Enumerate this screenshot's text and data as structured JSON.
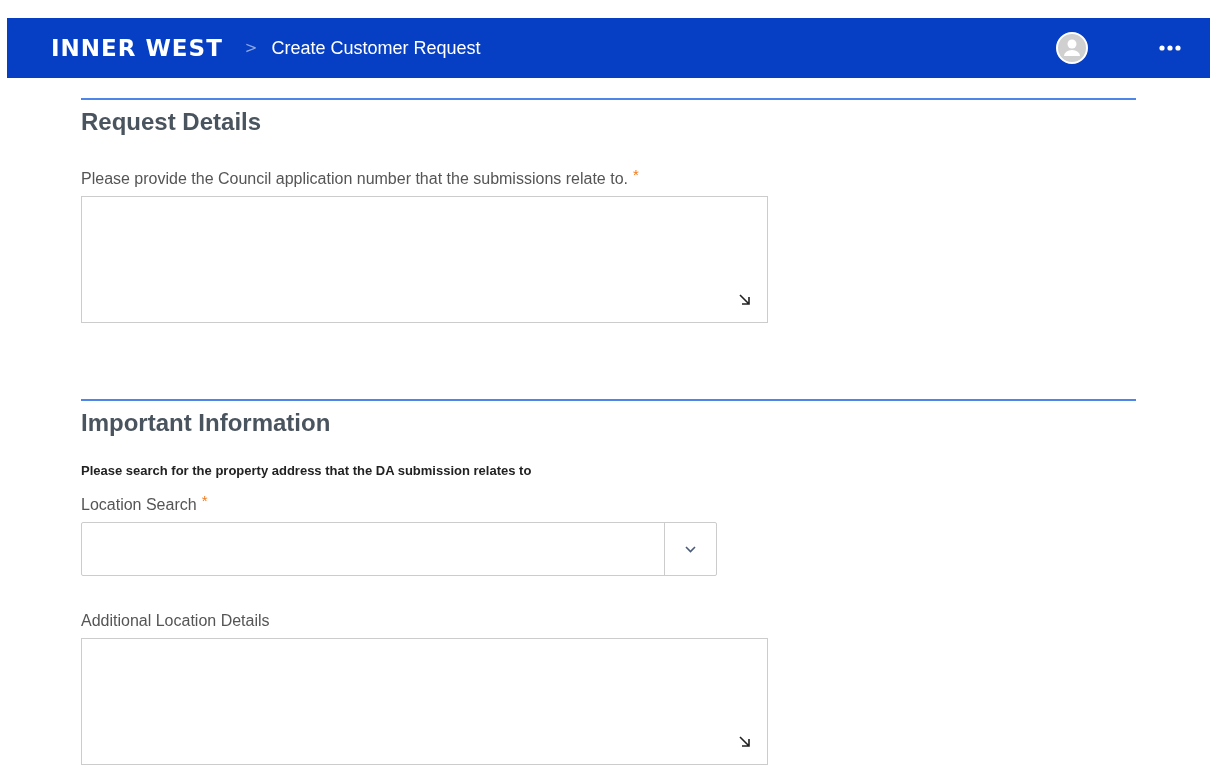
{
  "header": {
    "logo": "INNER WEST",
    "breadcrumb_separator": ">",
    "breadcrumb": "Create Customer Request"
  },
  "sections": [
    {
      "title": "Request Details",
      "fields": [
        {
          "kind": "textarea",
          "label": "Please provide the Council application number that the submissions relate to.",
          "required_mark": "*"
        }
      ]
    },
    {
      "title": "Important Information",
      "note": "Please search for the property address that the DA submission relates to",
      "fields": [
        {
          "kind": "select",
          "label": "Location Search",
          "required_mark": "*"
        },
        {
          "kind": "textarea",
          "label": "Additional Location Details"
        }
      ]
    }
  ]
}
